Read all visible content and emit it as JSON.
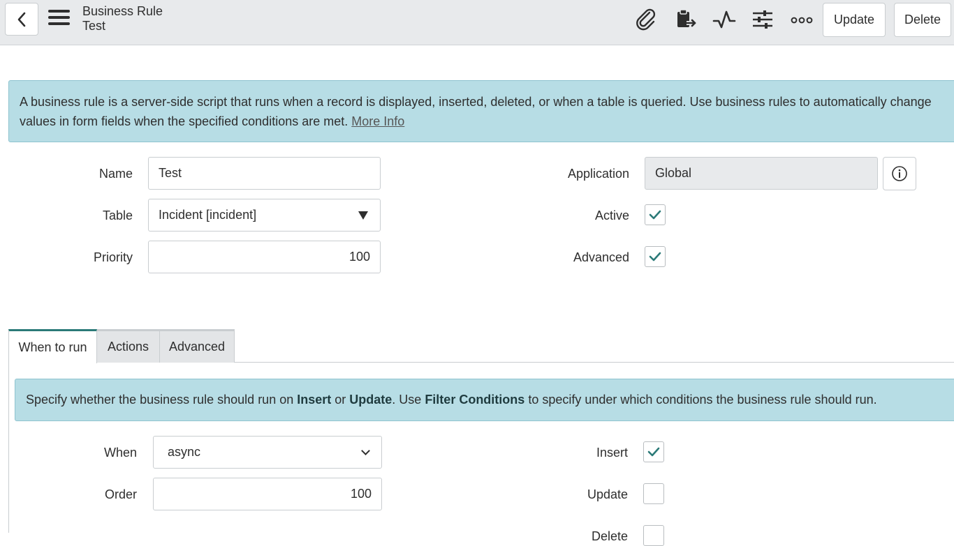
{
  "header": {
    "record_type": "Business Rule",
    "record_name": "Test",
    "icons": [
      "paperclip-icon",
      "clipboard-export-icon",
      "activity-pulse-icon",
      "sliders-icon",
      "more-options-icon"
    ],
    "update_label": "Update",
    "delete_label": "Delete"
  },
  "info": {
    "text": "A business rule is a server-side script that runs when a record is displayed, inserted, deleted, or when a table is queried. Use business rules to automatically change values in form fields when the specified conditions are met.",
    "link_text": "More Info"
  },
  "form": {
    "name_label": "Name",
    "name_value": "Test",
    "table_label": "Table",
    "table_value": "Incident [incident]",
    "priority_label": "Priority",
    "priority_value": "100",
    "application_label": "Application",
    "application_value": "Global",
    "active_label": "Active",
    "active_checked": true,
    "advanced_label": "Advanced",
    "advanced_checked": true
  },
  "tabs": [
    {
      "label": "When to run",
      "active": true
    },
    {
      "label": "Actions",
      "active": false
    },
    {
      "label": "Advanced",
      "active": false
    }
  ],
  "when_to_run": {
    "info_pre": "Specify whether the business rule should run on ",
    "info_insert": "Insert",
    "info_or": " or ",
    "info_update": "Update",
    "info_mid": ". Use ",
    "info_filter": "Filter Conditions",
    "info_post": " to specify under which conditions the business rule should run.",
    "when_label": "When",
    "when_value": "async",
    "order_label": "Order",
    "order_value": "100",
    "insert_label": "Insert",
    "insert_checked": true,
    "update_label": "Update",
    "update_checked": false,
    "delete_label": "Delete"
  },
  "colors": {
    "accent": "#2b7a78",
    "info_bg": "#b7dde5",
    "header_bg": "#e8eaec"
  }
}
